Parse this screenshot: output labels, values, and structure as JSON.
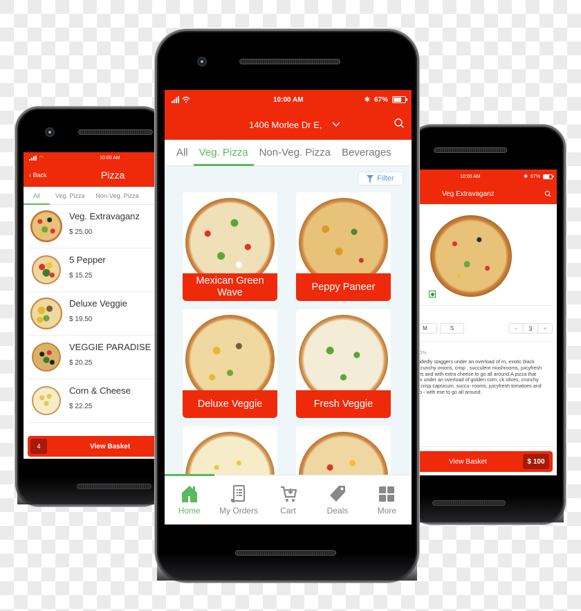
{
  "colors": {
    "brand_red": "#ee2a0b",
    "accent_green": "#5cb85c",
    "link_blue": "#5a9bd4",
    "badge_dark_red": "#a51a08"
  },
  "left_phone": {
    "status": {
      "time": "10:00 AM"
    },
    "header": {
      "back_label": "‹ Back",
      "title": "Pizza"
    },
    "tabs": [
      {
        "label": "All",
        "active": true
      },
      {
        "label": "Veg. Pizza",
        "active": false
      },
      {
        "label": "Non-Veg. Pizza",
        "active": false
      }
    ],
    "items": [
      {
        "name": "Veg. Extravaganz",
        "price": "$ 25.00",
        "image": "veg-extravaganza"
      },
      {
        "name": "5 Pepper",
        "price": "$ 15.25",
        "image": "5-pepper"
      },
      {
        "name": "Deluxe Veggie",
        "price": "$ 19.50",
        "image": "deluxe-veggie"
      },
      {
        "name": "VEGGIE PARADISE",
        "price": "$ 20.25",
        "image": "veggie-paradise"
      },
      {
        "name": "Corn & Cheese",
        "price": "$ 22.25",
        "image": "corn-cheese"
      }
    ],
    "basket": {
      "count": "4",
      "label": "View Basket"
    }
  },
  "center_phone": {
    "status": {
      "time": "10:00 AM",
      "battery": "67%",
      "battery_level": 0.67
    },
    "header": {
      "address": "1406 Morlee Dr E,",
      "dropdown_icon": "chevron-down-icon",
      "search_icon": "search-icon"
    },
    "tabs": [
      {
        "label": "All",
        "active": false
      },
      {
        "label": "Veg. Pizza",
        "active": true
      },
      {
        "label": "Non-Veg. Pizza",
        "active": false
      },
      {
        "label": "Beverages",
        "active": false
      }
    ],
    "filter_label": "Filter",
    "products": [
      {
        "name": "Mexican Green Wave",
        "image": "mexican-green-wave"
      },
      {
        "name": "Peppy Paneer",
        "image": "peppy-paneer"
      },
      {
        "name": "Deluxe Veggie",
        "image": "deluxe-veggie"
      },
      {
        "name": "Fresh Veggie",
        "image": "fresh-veggie"
      },
      {
        "name": "",
        "image": "corn-cheese"
      },
      {
        "name": "",
        "image": "5-pepper"
      }
    ],
    "bottom_nav": [
      {
        "label": "Home",
        "icon": "home-icon",
        "active": true
      },
      {
        "label": "My Orders",
        "icon": "receipt-icon",
        "active": false
      },
      {
        "label": "Cart",
        "icon": "cart-icon",
        "active": false
      },
      {
        "label": "Deals",
        "icon": "tag-icon",
        "active": false
      },
      {
        "label": "More",
        "icon": "grid-icon",
        "active": false
      }
    ]
  },
  "right_phone": {
    "status": {
      "time": "10:00 AM",
      "battery": "67%",
      "battery_level": 0.67
    },
    "header": {
      "title": "Veg Extravaganz"
    },
    "sizes": [
      {
        "label": "M"
      },
      {
        "label": "S"
      }
    ],
    "quantity": {
      "minus": "−",
      "value": "3",
      "plus": "+"
    },
    "description_label": "ON",
    "description": "hat decidedly staggers under an overload of rn, exotic black olives, crunchy onions, crisp , succulent mushrooms, juicyfresh tomatoes and with extra cheese to go all around.A pizza that staggers under an overload of golden corn, ck olives, crunchy onions, crisp capsicum, succu- rooms, juicyfresh tomatoes and jalapeno - with ese to go all around.",
    "basket": {
      "label": "View Basket",
      "total": "$ 100"
    }
  }
}
